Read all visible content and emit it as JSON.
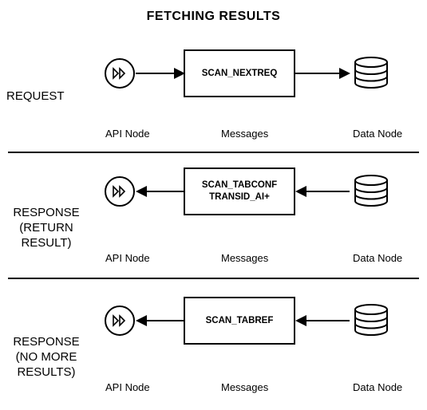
{
  "title": "FETCHING RESULTS",
  "columns": {
    "api": "API Node",
    "messages": "Messages",
    "data": "Data Node"
  },
  "rows": [
    {
      "label": "REQUEST",
      "messages": [
        "SCAN_NEXTREQ"
      ],
      "direction": "right"
    },
    {
      "label": "RESPONSE\n(RETURN\nRESULT)",
      "messages": [
        "SCAN_TABCONF",
        "TRANSID_AI+"
      ],
      "direction": "left"
    },
    {
      "label": "RESPONSE\n(NO MORE\nRESULTS)",
      "messages": [
        "SCAN_TABREF"
      ],
      "direction": "left"
    }
  ]
}
